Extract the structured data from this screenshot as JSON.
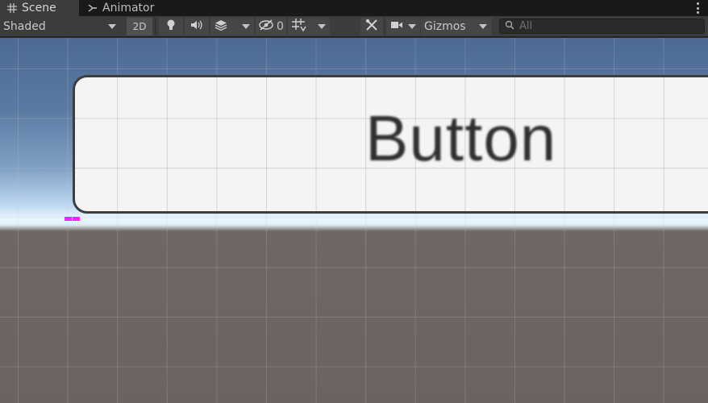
{
  "tabs": [
    {
      "label": "Scene",
      "icon": "grid-hash-icon",
      "active": true
    },
    {
      "label": "Animator",
      "icon": "animator-icon",
      "active": false
    }
  ],
  "toolbar": {
    "draw_mode": "Shaded",
    "mode_2d": "2D",
    "hidden_count": "0",
    "gizmos_label": "Gizmos",
    "search_placeholder": "All"
  },
  "scene": {
    "button_text": "Button"
  },
  "colors": {
    "tab_bar": "#191919",
    "toolbar": "#3c3c3c",
    "pivot": "#ff1fff",
    "sky_top": "#4c6a93",
    "ground": "#6b6360"
  }
}
